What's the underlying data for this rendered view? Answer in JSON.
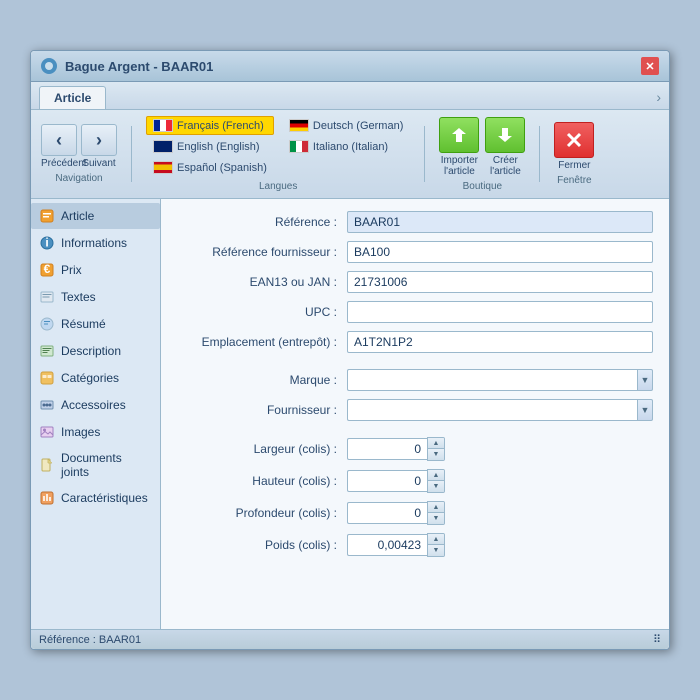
{
  "window": {
    "title": "Bague Argent - BAAR01",
    "close_label": "✕"
  },
  "tabs": [
    {
      "label": "Article",
      "active": true
    }
  ],
  "toolbar": {
    "nav": {
      "prev_label": "Précédent",
      "next_label": "Suivant",
      "group_label": "Navigation"
    },
    "languages": {
      "group_label": "Langues",
      "items": [
        {
          "code": "fr",
          "label": "Français (French)",
          "active": true
        },
        {
          "code": "en",
          "label": "English (English)",
          "active": false
        },
        {
          "code": "es",
          "label": "Español (Spanish)",
          "active": false
        },
        {
          "code": "de",
          "label": "Deutsch (German)",
          "active": false
        },
        {
          "code": "it",
          "label": "Italiano (Italian)",
          "active": false
        }
      ]
    },
    "boutique": {
      "group_label": "Boutique",
      "import_label": "Importer\nl'article",
      "create_label": "Créer\nl'article"
    },
    "fenetre": {
      "group_label": "Fenêtre",
      "close_label": "Fermer"
    }
  },
  "sidebar": {
    "items": [
      {
        "id": "article",
        "label": "Article",
        "active": true,
        "icon": "article"
      },
      {
        "id": "informations",
        "label": "Informations",
        "active": false,
        "icon": "info"
      },
      {
        "id": "prix",
        "label": "Prix",
        "active": false,
        "icon": "prix"
      },
      {
        "id": "textes",
        "label": "Textes",
        "active": false,
        "icon": "textes"
      },
      {
        "id": "resume",
        "label": "Résumé",
        "active": false,
        "icon": "resume"
      },
      {
        "id": "description",
        "label": "Description",
        "active": false,
        "icon": "desc"
      },
      {
        "id": "categories",
        "label": "Catégories",
        "active": false,
        "icon": "cat"
      },
      {
        "id": "accessoires",
        "label": "Accessoires",
        "active": false,
        "icon": "acc"
      },
      {
        "id": "images",
        "label": "Images",
        "active": false,
        "icon": "img"
      },
      {
        "id": "documents",
        "label": "Documents joints",
        "active": false,
        "icon": "doc"
      },
      {
        "id": "caracteristiques",
        "label": "Caractéristiques",
        "active": false,
        "icon": "car"
      }
    ]
  },
  "form": {
    "reference_label": "Référence :",
    "reference_value": "BAAR01",
    "ref_fournisseur_label": "Référence fournisseur :",
    "ref_fournisseur_value": "BA100",
    "ean13_label": "EAN13 ou JAN :",
    "ean13_value": "21731006",
    "upc_label": "UPC :",
    "upc_value": "",
    "emplacement_label": "Emplacement (entrepôt) :",
    "emplacement_value": "A1T2N1P2",
    "marque_label": "Marque :",
    "marque_value": "",
    "fournisseur_label": "Fournisseur :",
    "fournisseur_value": "",
    "largeur_label": "Largeur (colis) :",
    "largeur_value": "0",
    "hauteur_label": "Hauteur (colis) :",
    "hauteur_value": "0",
    "profondeur_label": "Profondeur (colis) :",
    "profondeur_value": "0",
    "poids_label": "Poids (colis) :",
    "poids_value": "0,00423"
  },
  "status": {
    "text": "Référence : BAAR01"
  },
  "colors": {
    "accent": "#4a8fc0",
    "sidebar_active": "#b8ccdf",
    "input_border": "#9ab8cc"
  }
}
